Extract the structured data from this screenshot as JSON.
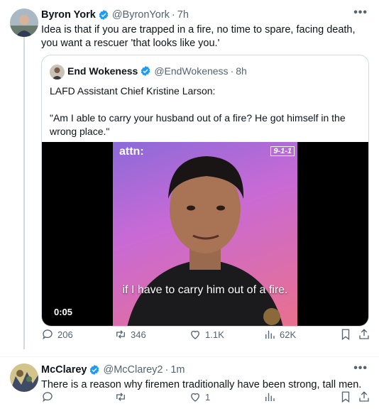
{
  "tweet1": {
    "name": "Byron York",
    "handle": "@ByronYork",
    "separator": "·",
    "time": "7h",
    "more": "•••",
    "text": "Idea is that if you are trapped in a fire, no time to spare, facing death, you want a rescuer 'that looks like you.'",
    "quote": {
      "name": "End Wokeness",
      "handle": "@EndWokeness",
      "separator": "·",
      "time": "8h",
      "text_line1": "LAFD Assistant Chief Kristine Larson:",
      "text_line2": "\"Am I able to carry your husband out of a fire? He got himself in the wrong place.\"",
      "video": {
        "watermark": "attn:",
        "network_logo": "9-1-1",
        "caption": "if I have to carry him out of a fire.",
        "duration": "0:05"
      }
    },
    "stats": {
      "replies": "206",
      "reposts": "346",
      "likes": "1.1K",
      "views": "62K"
    }
  },
  "tweet2": {
    "name": "McClarey",
    "handle": "@McClarey2",
    "separator": "·",
    "time": "1m",
    "more": "•••",
    "text": "There is a reason why firemen traditionally have been strong, tall men.",
    "stats": {
      "likes": "1"
    }
  },
  "colors": {
    "verified": "#1d9bf0",
    "muted": "#536471",
    "border": "#cfd9de"
  }
}
